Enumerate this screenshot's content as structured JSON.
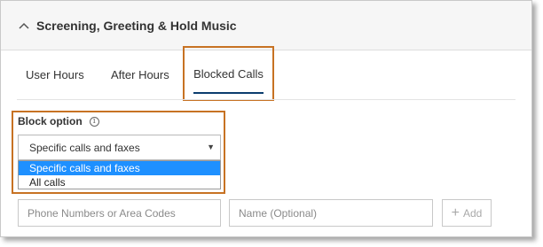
{
  "section": {
    "title": "Screening, Greeting & Hold Music"
  },
  "tabs": [
    {
      "label": "User Hours"
    },
    {
      "label": "After Hours"
    },
    {
      "label": "Blocked Calls",
      "active": true
    }
  ],
  "block_option": {
    "label": "Block option",
    "info_icon": "info-icon",
    "selected_value": "Specific calls and faxes",
    "options": [
      {
        "label": "Specific calls and faxes",
        "highlighted": true
      },
      {
        "label": "All calls"
      }
    ]
  },
  "entry": {
    "phone_placeholder": "Phone Numbers or Area Codes",
    "name_placeholder": "Name (Optional)",
    "add_label": "Add"
  },
  "colors": {
    "highlight_border": "#c77223",
    "active_tab_underline": "#0b3d6e",
    "selected_option": "#1e90ff"
  }
}
